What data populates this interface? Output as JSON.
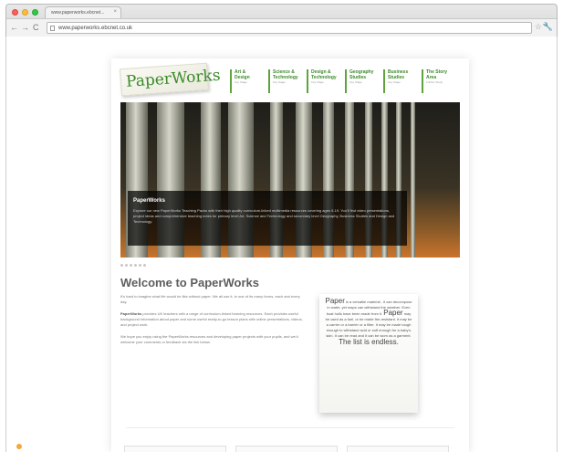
{
  "browser": {
    "tab_title": "www.paperworks.ebcnet...",
    "tab_close": "×",
    "url": "www.paperworks.ebcnet.co.uk",
    "back": "←",
    "forward": "→",
    "reload": "C",
    "star": "☆",
    "menu": "🔧"
  },
  "site": {
    "logo": "PaperWorks",
    "nav": [
      {
        "label": "Art &",
        "label2": "Design",
        "sub": "Key Stage"
      },
      {
        "label": "Science &",
        "label2": "Technology",
        "sub": "Key Stage"
      },
      {
        "label": "Design &",
        "label2": "Technology",
        "sub": "Key Stage"
      },
      {
        "label": "Geography",
        "label2": "Studies",
        "sub": "Key Stage"
      },
      {
        "label": "Business",
        "label2": "Studies",
        "sub": "Key Stage"
      },
      {
        "label": "The Story",
        "label2": "Area",
        "sub": "Further Study"
      }
    ],
    "hero": {
      "title": "PaperWorks",
      "text": "Explore our new PaperWorks Teaching Packs with their high quality curriculum-linked multimedia resources covering ages 5-19. You'll find video presentations, project ideas and comprehensive teaching notes for primary level Art, Science and Technology and secondary level Geography, Business Studies and Design and Technology."
    },
    "welcome_title": "Welcome to PaperWorks",
    "paragraphs": [
      {
        "text": "It's hard to imagine what life would be like without paper. We all use it, in one of its many forms, each and every day."
      },
      {
        "lead": "PaperWorks",
        "text": " provides UK teachers with a range of curriculum-linked learning resources. Each provides useful background information about paper and some useful ready-to-go lesson plans with online presentations, videos, and project work."
      },
      {
        "text": "We hope you enjoy using the PaperWorks resources and developing paper projects with your pupils, and we'd welcome your comments or feedback via the link below."
      }
    ],
    "paper_note": {
      "word1": "Paper",
      "text1": " is a versatile material - it can decompose in water, yet maps can withstand the weather. Even boat hulls have been made from it.",
      "word2": "Paper",
      "text2": " may be used as a fuel, or be made fire-resistant. It may be a carrier or a barrier or a filter. It may be made tough enough to withstand acid or soft enough for a baby's skin. It can be read and it can be worn as a garment.",
      "closing": "The list is endless."
    }
  }
}
